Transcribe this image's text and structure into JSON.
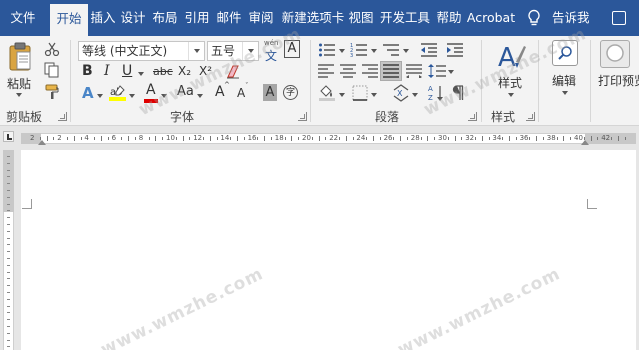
{
  "tabs": [
    "文件",
    "开始",
    "插入",
    "设计",
    "布局",
    "引用",
    "邮件",
    "审阅",
    "新建选项卡",
    "视图",
    "开发工具",
    "帮助",
    "Acrobat"
  ],
  "tell_me": "告诉我",
  "clipboard": {
    "paste_label": "粘贴",
    "group_label": "剪贴板"
  },
  "font": {
    "name": "等线 (中文正文)",
    "size": "五号",
    "wen_top": "wén",
    "wen_bottom": "文",
    "big_a": "A",
    "bold": "B",
    "italic": "I",
    "underline": "U",
    "strike": "abc",
    "subscript": "X₂",
    "superscript": "X²",
    "text_effects": "A",
    "font_color": "A",
    "change_case": "Aa",
    "grow": "A",
    "shrink": "A",
    "shading": "A",
    "enclose": "字",
    "group_label": "字体"
  },
  "paragraph": {
    "group_label": "段落",
    "sort_glyph": "A↓Z"
  },
  "styles": {
    "label": "样式",
    "group_label": "样式"
  },
  "editing": {
    "label": "编辑"
  },
  "print_preview": {
    "label": "打印预览"
  },
  "ruler_numbers": [
    "2",
    "2",
    "4",
    "6",
    "8",
    "10",
    "12",
    "14",
    "16",
    "18",
    "20",
    "22",
    "24",
    "26",
    "28",
    "30",
    "32",
    "34",
    "36",
    "38",
    "40",
    "42"
  ],
  "watermark": "www.wmzhe.com",
  "colors": {
    "tab_bar": "#2b579a",
    "ribbon": "#f3f3f3",
    "highlight_yellow": "#ffff00",
    "font_red": "#e00000"
  }
}
